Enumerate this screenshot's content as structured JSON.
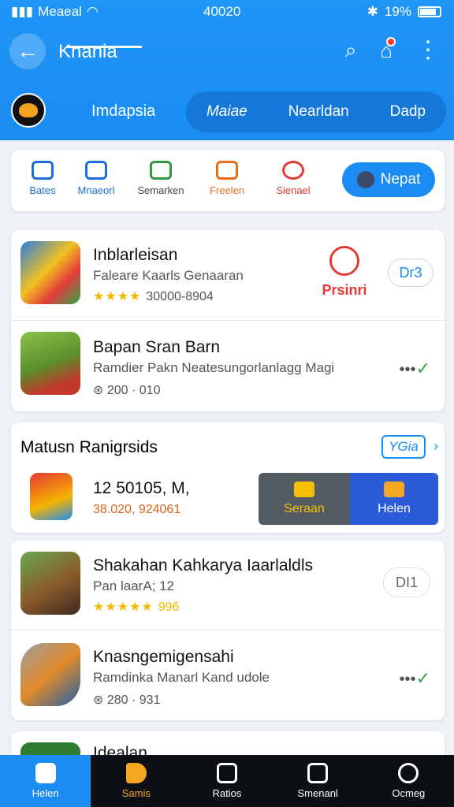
{
  "status_bar": {
    "carrier": "Meaeal",
    "time": "40020",
    "battery": "19%"
  },
  "app_bar": {
    "title": "Knania"
  },
  "tabs": {
    "active": "Imdapsia",
    "items": [
      "Maiae",
      "Nearldan",
      "Dadp"
    ]
  },
  "categories": [
    {
      "label": "Bates",
      "color": "#1a6fd1"
    },
    {
      "label": "Mnaeorl",
      "color": "#1a6fd1"
    },
    {
      "label": "Semarken",
      "color": "#2e9a45"
    },
    {
      "label": "Freelen",
      "color": "#ef6c1b"
    },
    {
      "label": "Sienael",
      "color": "#e53935"
    }
  ],
  "repeat_button": {
    "label": "Nepat"
  },
  "list1": [
    {
      "title": "Inblarleisan",
      "subtitle": "Faleare Kaarls Genaaran",
      "meta": "30000-8904",
      "badge": "Prsinri",
      "tag": "Dr3"
    },
    {
      "title": "Bapan Sran Barn",
      "subtitle": "Ramdier Pakn Neatesungorlanlagg Magi",
      "meta": "200 · 010"
    }
  ],
  "section": {
    "title": "Matusn Ranigrsids",
    "more_label": "YGia",
    "item_title": "12 50105, M,",
    "item_meta": "38.020, 924061",
    "action_left": "Seraan",
    "action_right": "Helen"
  },
  "list2": [
    {
      "title": "Shakahan Kahkarya Iaarlaldls",
      "subtitle": "Pan laarA; 12",
      "meta": "996",
      "tag": "DI1"
    },
    {
      "title": "Knasngemigensahi",
      "subtitle": "Ramdinka Manarl Kand udole",
      "meta": "280 · 931"
    },
    {
      "title": "Idealan"
    }
  ],
  "bottom_nav": [
    {
      "label": "Helen"
    },
    {
      "label": "Samis"
    },
    {
      "label": "Ratios"
    },
    {
      "label": "Smenanl"
    },
    {
      "label": "Ocmeg"
    }
  ],
  "colors": {
    "primary": "#1a8cf3",
    "nav_bg": "#0c0f14",
    "highlight": "#f5a623"
  }
}
